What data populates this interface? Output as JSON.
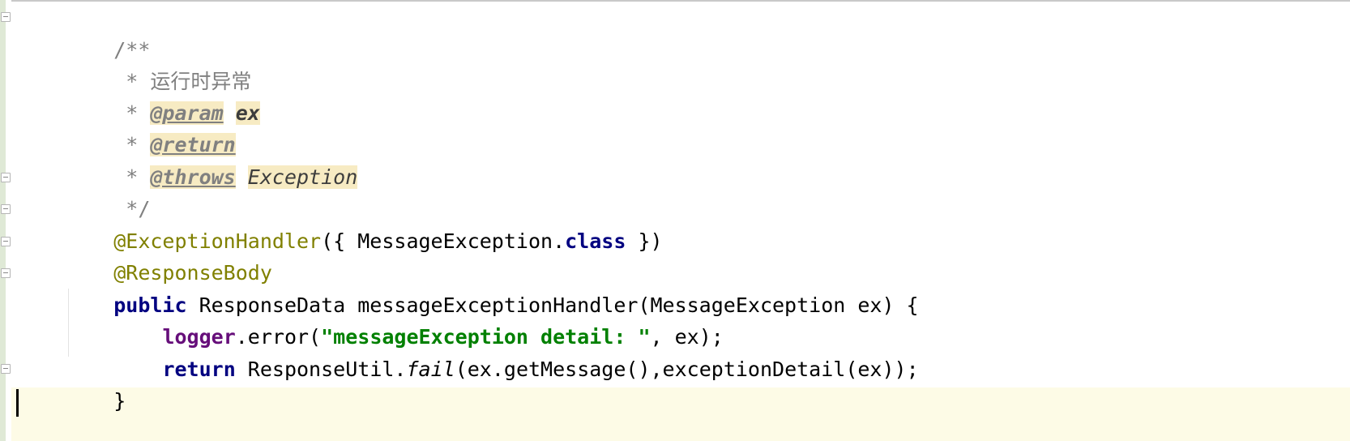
{
  "editor": {
    "colors": {
      "background": "#ffffff",
      "current_line": "#fdfbe6",
      "comment": "#808080",
      "annotation": "#808000",
      "keyword": "#000080",
      "field": "#660e7a",
      "string": "#008000",
      "tag_highlight": "#f7ebc3",
      "gutter_change": "#dfe9d6"
    },
    "lines": {
      "l1": {
        "open": "/**"
      },
      "l2": {
        "star": " * ",
        "text": "运行时异常"
      },
      "l3": {
        "star": " * ",
        "tag": "@param",
        "sp": " ",
        "name": "ex"
      },
      "l4": {
        "star": " * ",
        "tag": "@return"
      },
      "l5": {
        "star": " * ",
        "tag": "@throws",
        "sp": " ",
        "type": "Exception"
      },
      "l6": {
        "close": " */"
      },
      "l7": {
        "anno": "@ExceptionHandler",
        "p1": "({ MessageException.",
        "kw": "class",
        "p2": " })"
      },
      "l8": {
        "anno": "@ResponseBody"
      },
      "l9": {
        "kw": "public",
        "rest": " ResponseData messageExceptionHandler(MessageException ex) {"
      },
      "l10": {
        "indent": "    ",
        "field": "logger",
        "p1": ".error(",
        "str": "\"messageException detail: \"",
        "p2": ", ex);"
      },
      "l11": {
        "indent": "    ",
        "kw": "return",
        "p1": " ResponseUtil.",
        "method": "fail",
        "p2": "(ex.getMessage(),exceptionDetail(ex));"
      },
      "l12": {
        "brace": "}"
      }
    },
    "gutter": {
      "fold_icons": [
        "fold-marker",
        "fold-marker",
        "fold-marker",
        "fold-marker",
        "fold-marker",
        "fold-marker",
        "fold-marker"
      ]
    }
  }
}
